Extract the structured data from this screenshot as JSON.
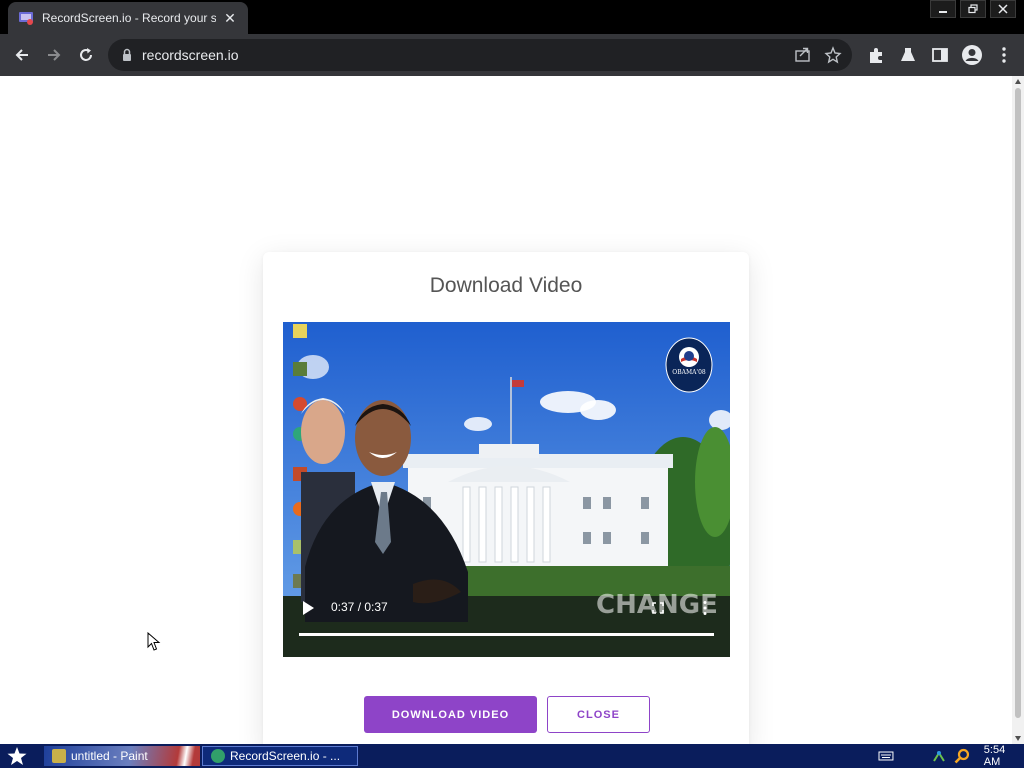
{
  "browser": {
    "tab_title": "RecordScreen.io - Record your scre",
    "url": "recordscreen.io"
  },
  "modal": {
    "title": "Download Video",
    "video": {
      "current_time": "0:37",
      "duration": "0:37",
      "time_label": "0:37 / 0:37",
      "progress": 1.0,
      "overlay_text": "CHANGE",
      "logo_text": "OBAMA'08"
    },
    "download_label": "DOWNLOAD VIDEO",
    "close_label": "CLOSE"
  },
  "taskbar": {
    "items": [
      {
        "label": "untitled - Paint"
      },
      {
        "label": "RecordScreen.io - ..."
      }
    ],
    "clock": "5:54 AM"
  },
  "colors": {
    "accent": "#8e44c8",
    "browser_frame": "#35363a",
    "taskbar": "#0a1d5c"
  }
}
